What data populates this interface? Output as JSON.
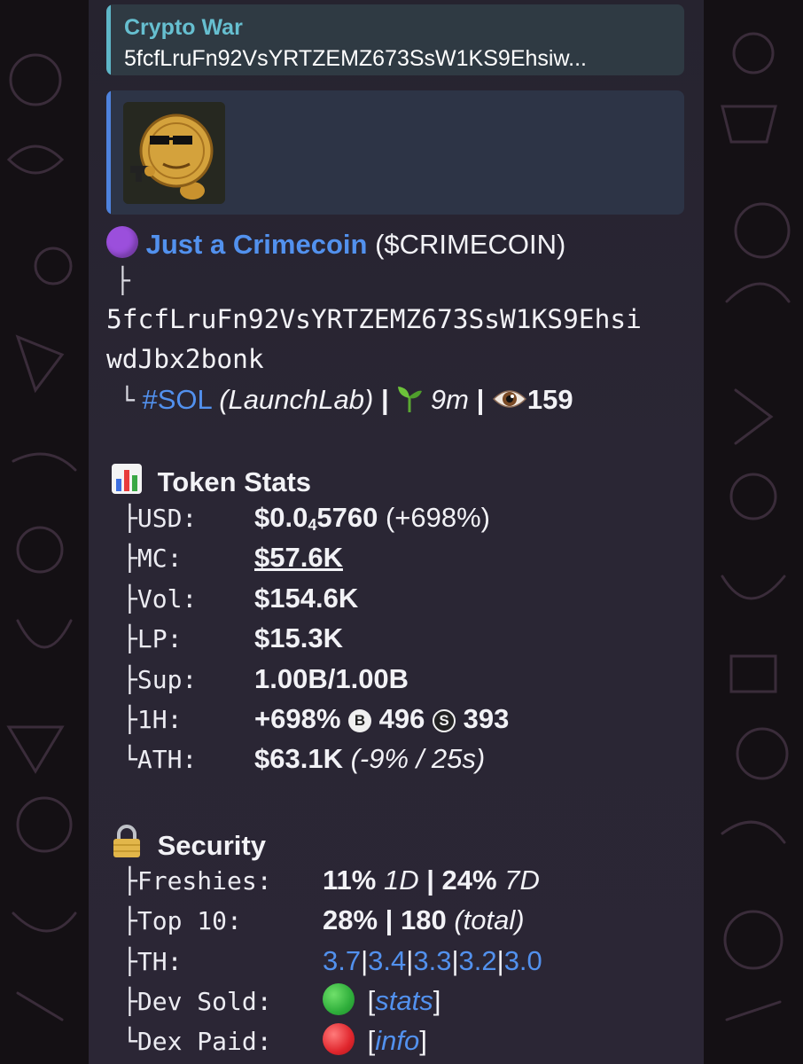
{
  "reply": {
    "title": "Crypto War",
    "text": "5fcfLruFn92VsYRTZEMZ673SsW1KS9Ehsiw..."
  },
  "preview": {
    "image_icon": "crimecoin-logo"
  },
  "token": {
    "status_dot_color": "#9b4fdc",
    "name": "Just a Crimecoin",
    "ticker": "($CRIMECOIN)",
    "branch1": "├",
    "address_line1": "5fcfLruFn92VsYRTZEMZ673SsW1KS9Ehsi",
    "address_line2": "wdJbx2bonk",
    "branch2": "└",
    "chain": "#SOL",
    "platform": "(LaunchLab)",
    "sep": "|",
    "age": "9m",
    "views": "159",
    "age_icon": "seedling-icon",
    "views_icon": "eye-icon"
  },
  "stats": {
    "title": "Token Stats",
    "icon": "bar-chart-icon",
    "rows": [
      {
        "prefix": "├",
        "label": "USD:",
        "value_main": "$0.0",
        "value_sub": "4",
        "value_rest": "5760",
        "value_extra": " (+698%)"
      },
      {
        "prefix": "├",
        "label": "MC:",
        "value": "$57.6K"
      },
      {
        "prefix": "├",
        "label": "Vol:",
        "value": "$154.6K"
      },
      {
        "prefix": "├",
        "label": "LP:",
        "value": "$15.3K"
      },
      {
        "prefix": "├",
        "label": "Sup:",
        "value": "1.00B/1.00B"
      },
      {
        "prefix": "├",
        "label": "1H:",
        "value": "+698%",
        "buy_badge": "B",
        "buys": "496",
        "sell_badge": "S",
        "sells": "393"
      },
      {
        "prefix": "└",
        "label": "ATH:",
        "value": "$63.1K",
        "value_extra": "(-9% / 25s)"
      }
    ]
  },
  "security": {
    "title": "Security",
    "icon": "lock-icon",
    "rows": [
      {
        "prefix": "├",
        "label": "Freshies:",
        "v1": "11%",
        "v1_note": "1D",
        "sep": "|",
        "v2": "24%",
        "v2_note": "7D"
      },
      {
        "prefix": "├",
        "label": "Top 10:",
        "v1": "28%",
        "sep": "|",
        "v2": "180",
        "v2_note": "(total)"
      },
      {
        "prefix": "├",
        "label": "TH:",
        "holders": [
          "3.7",
          "3.4",
          "3.3",
          "3.2",
          "3.0"
        ],
        "sep": "|"
      },
      {
        "prefix": "├",
        "label": "Dev Sold:",
        "dot_color": "#2fae3b",
        "link_text": "stats",
        "bracket_open": "[",
        "bracket_close": "]"
      },
      {
        "prefix": "└",
        "label": "Dex Paid:",
        "dot_color": "#e0262d",
        "link_text": "info",
        "bracket_open": "[",
        "bracket_close": "]"
      }
    ]
  }
}
